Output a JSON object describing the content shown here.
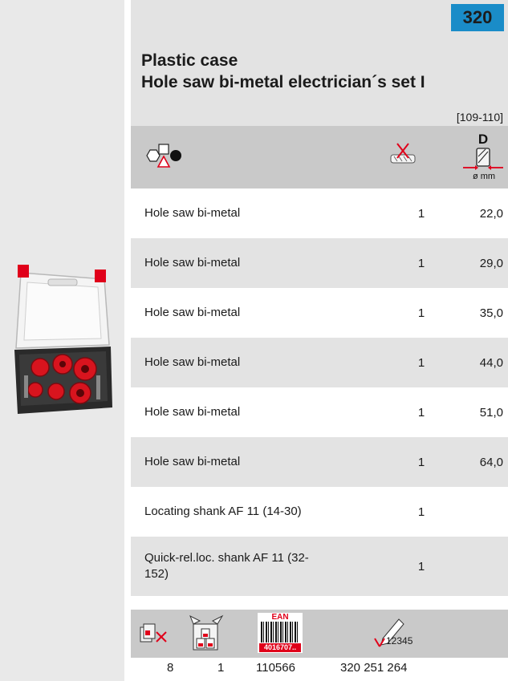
{
  "page_number": "320",
  "title": {
    "line1": "Plastic case",
    "line2": "Hole saw bi-metal electrician´s set I"
  },
  "reference": "[109-110]",
  "header": {
    "dia_letter": "D",
    "dia_unit": "ø mm"
  },
  "items": [
    {
      "name": "Hole saw bi-metal",
      "qty": "1",
      "dia": "22,0"
    },
    {
      "name": "Hole saw bi-metal",
      "qty": "1",
      "dia": "29,0"
    },
    {
      "name": "Hole saw bi-metal",
      "qty": "1",
      "dia": "35,0"
    },
    {
      "name": "Hole saw bi-metal",
      "qty": "1",
      "dia": "44,0"
    },
    {
      "name": "Hole saw bi-metal",
      "qty": "1",
      "dia": "51,0"
    },
    {
      "name": "Hole saw bi-metal",
      "qty": "1",
      "dia": "64,0"
    },
    {
      "name": "Locating shank AF 11 (14-30)",
      "qty": "1",
      "dia": ""
    },
    {
      "name": "Quick-rel.loc. shank AF 11 (32-152)",
      "qty": "1",
      "dia": ""
    }
  ],
  "footer": {
    "ean_label": "EAN",
    "ean_digits": "4016707..",
    "marking_number": "12345",
    "values": {
      "pieces": "8",
      "packing_unit": "1",
      "ean_code": "110566",
      "article_number": "320 251 264"
    }
  },
  "colors": {
    "accent": "#1a8cc8",
    "band_light": "#e3e3e3",
    "band_dark": "#c9c9c9",
    "red": "#e0001a"
  }
}
